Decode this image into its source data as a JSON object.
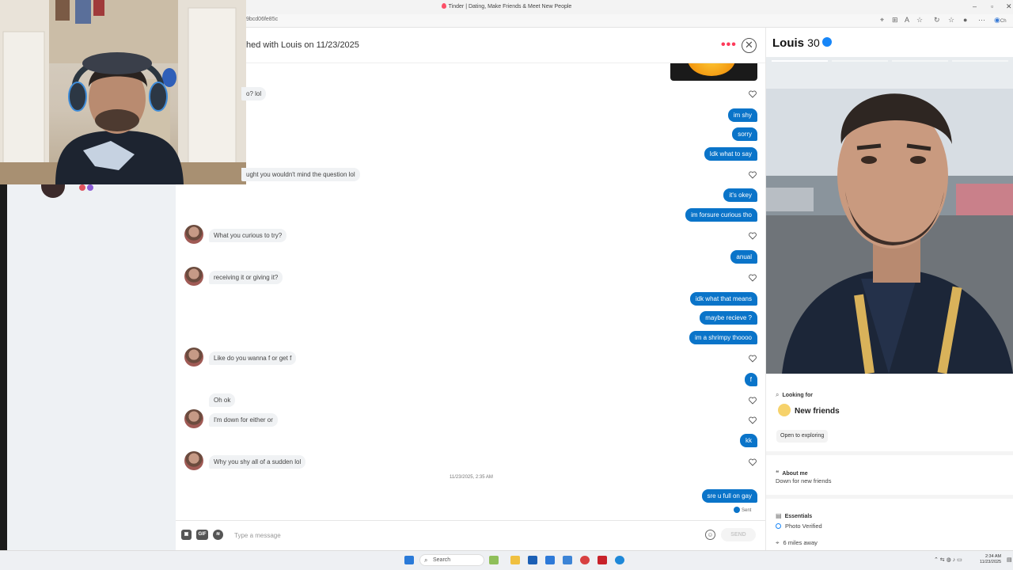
{
  "browser": {
    "tab_title": "Tinder | Dating, Make Friends & Meet New People",
    "url": "9bcd06fe85c",
    "copilot_label": "Ch"
  },
  "chat": {
    "header_text": "hed with Louis on 11/23/2025",
    "messages": [
      {
        "dir": "in",
        "text": "o? lol",
        "avatar": false
      },
      {
        "dir": "out",
        "text": "im shy"
      },
      {
        "dir": "out",
        "text": "sorry"
      },
      {
        "dir": "out",
        "text": "Idk what to say"
      },
      {
        "dir": "in",
        "text": "ught you wouldn't mind the question lol",
        "avatar": false
      },
      {
        "dir": "out",
        "text": "it's okey"
      },
      {
        "dir": "out",
        "text": "im forsure curious tho"
      },
      {
        "dir": "in",
        "text": "What you curious to try?",
        "avatar": true
      },
      {
        "dir": "out",
        "text": "anual"
      },
      {
        "dir": "in",
        "text": "receiving it or giving it?",
        "avatar": true
      },
      {
        "dir": "out",
        "text": "idk what that means"
      },
      {
        "dir": "out",
        "text": "maybe recieve ?"
      },
      {
        "dir": "out",
        "text": "im a shrimpy thoooo"
      },
      {
        "dir": "in",
        "text": "Like do you wanna f or get f",
        "avatar": true
      },
      {
        "dir": "out",
        "text": "f"
      },
      {
        "dir": "in",
        "text": "Oh ok",
        "avatar": false
      },
      {
        "dir": "in",
        "text": "I'm down for either or",
        "avatar": true
      },
      {
        "dir": "out",
        "text": "kk"
      },
      {
        "dir": "in",
        "text": "Why you shy all of a sudden lol",
        "avatar": true
      },
      {
        "dir": "out",
        "text": "sre u full on gay"
      }
    ],
    "timestamp": "11/23/2025, 2:35 AM",
    "sent_label": "Sent",
    "input_placeholder": "Type a message",
    "gif_label": "GIF",
    "send_label": "SEND"
  },
  "profile": {
    "name": "Louis",
    "age": "30",
    "looking_for_label": "Looking for",
    "looking_for_value": "New friends",
    "looking_for_chip": "Open to exploring",
    "about_label": "About me",
    "about_text": "Down for new friends",
    "essentials_label": "Essentials",
    "essentials": [
      "Photo Verified",
      "6 miles away"
    ]
  },
  "taskbar": {
    "search_label": "Search",
    "time": "2:34 AM",
    "date": "11/23/2025"
  },
  "colors": {
    "outgoing_bubble": "#0a74c9",
    "tinder_accent": "#fd3a5a",
    "verified_badge": "#1786f8"
  }
}
